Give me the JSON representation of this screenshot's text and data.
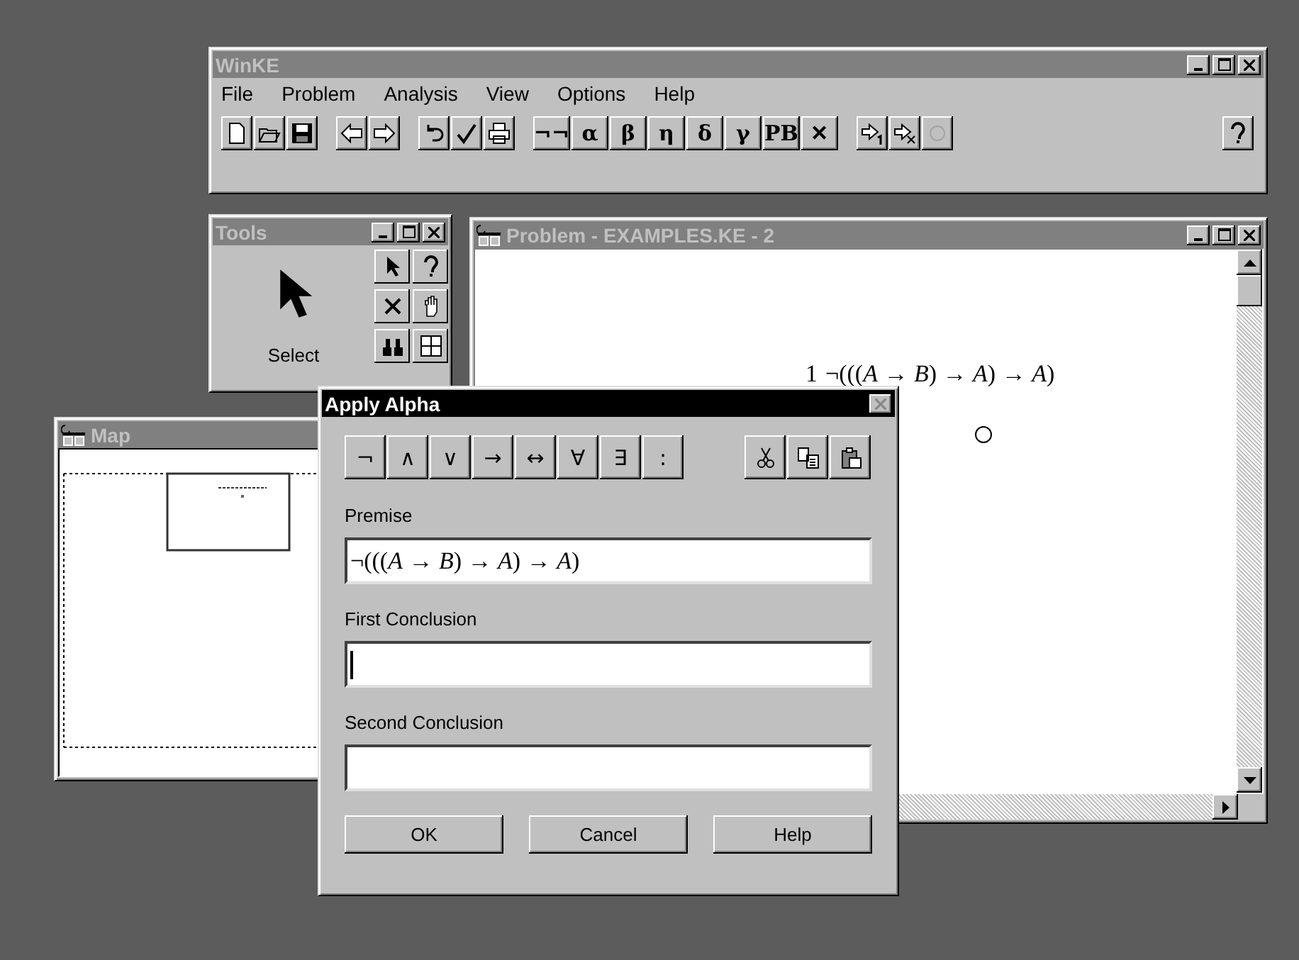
{
  "main_window": {
    "title": "WinKE",
    "menu": [
      "File",
      "Problem",
      "Analysis",
      "View",
      "Options",
      "Help"
    ],
    "toolbar": [
      [
        {
          "kind": "icon",
          "disabled": false
        },
        {
          "kind": "icon",
          "disabled": false
        },
        {
          "kind": "icon",
          "disabled": false
        }
      ],
      [
        {
          "kind": "icon",
          "disabled": false
        },
        {
          "kind": "icon",
          "disabled": false
        }
      ],
      [
        {
          "kind": "icon",
          "disabled": false
        },
        {
          "kind": "icon",
          "disabled": false
        },
        {
          "kind": "icon",
          "disabled": false
        }
      ],
      [
        {
          "kind": "text",
          "label": "¬¬",
          "disabled": false
        },
        {
          "kind": "text",
          "label": "α",
          "disabled": false
        },
        {
          "kind": "text",
          "label": "β",
          "disabled": false
        },
        {
          "kind": "text",
          "label": "η",
          "disabled": false
        },
        {
          "kind": "text",
          "label": "δ",
          "disabled": false
        },
        {
          "kind": "text",
          "label": "γ",
          "disabled": false
        },
        {
          "kind": "text",
          "label": "PB",
          "disabled": false
        },
        {
          "kind": "text",
          "label": "✕",
          "disabled": false
        }
      ],
      [
        {
          "kind": "icon",
          "disabled": false
        },
        {
          "kind": "icon",
          "disabled": false
        },
        {
          "kind": "icon",
          "disabled": true
        }
      ],
      [
        {
          "kind": "icon",
          "disabled": false
        }
      ]
    ]
  },
  "tools_window": {
    "title": "Tools",
    "current_tool": "Select"
  },
  "problem_window": {
    "title": "Problem - EXAMPLES.KE - 2",
    "formula_number": "1",
    "formula": "¬(((*A* → *B*) → *A*) → *A*)"
  },
  "map_window": {
    "title": "Map"
  },
  "dialog": {
    "title": "Apply Alpha",
    "symbols": [
      "¬",
      "∧",
      "∨",
      "→",
      "↔",
      "∀",
      "∃",
      ":"
    ],
    "fields": [
      {
        "label": "Premise",
        "value": "¬(((*A* → *B*) → *A*) → *A*)",
        "focused": false
      },
      {
        "label": "First Conclusion",
        "focused": true
      },
      {
        "label": "Second Conclusion",
        "focused": false
      }
    ],
    "buttons": [
      "OK",
      "Cancel",
      "Help"
    ]
  }
}
